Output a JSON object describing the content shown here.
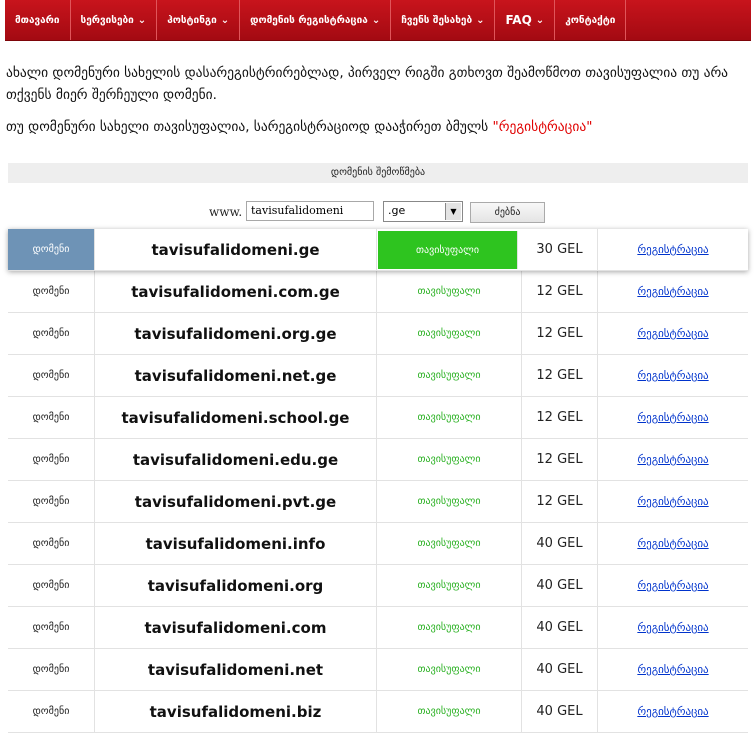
{
  "nav": {
    "items": [
      {
        "label": "მთავარი",
        "chevron": false
      },
      {
        "label": "სერვისები",
        "chevron": true
      },
      {
        "label": "ჰოსტინგი",
        "chevron": true
      },
      {
        "label": "დომენის რეგისტრაცია",
        "chevron": true
      },
      {
        "label": "ჩვენს შესახებ",
        "chevron": true
      },
      {
        "label": "FAQ",
        "chevron": true
      },
      {
        "label": "კონტაქტი",
        "chevron": false
      }
    ]
  },
  "intro": {
    "line1": "ახალი დომენური სახელის დასარეგისტრირებლად,  პირველ რიგში გთხოვთ შეამოწმოთ თავისუფალია თუ არა თქვენს მიერ შერჩეული დომენი.",
    "line2_prefix": "თუ დომენური სახელი თავისუფალია, სარეგისტრაციოდ დააჭირეთ ბმულს ",
    "line2_link": "\"რეგისტრაცია\""
  },
  "check": {
    "title": "დომენის შემოწმება",
    "www_label": "www.",
    "domain_value": "tavisufalidomeni",
    "tld_value": ".ge",
    "search_label": "ძებნა"
  },
  "results": [
    {
      "label": "დომენი",
      "domain": "tavisufalidomeni.ge",
      "status": "თავისუფალი",
      "price": "30 GEL",
      "action": "რეგისტრაცია"
    },
    {
      "label": "დომენი",
      "domain": "tavisufalidomeni.com.ge",
      "status": "თავისუფალი",
      "price": "12 GEL",
      "action": "რეგისტრაცია"
    },
    {
      "label": "დომენი",
      "domain": "tavisufalidomeni.org.ge",
      "status": "თავისუფალი",
      "price": "12 GEL",
      "action": "რეგისტრაცია"
    },
    {
      "label": "დომენი",
      "domain": "tavisufalidomeni.net.ge",
      "status": "თავისუფალი",
      "price": "12 GEL",
      "action": "რეგისტრაცია"
    },
    {
      "label": "დომენი",
      "domain": "tavisufalidomeni.school.ge",
      "status": "თავისუფალი",
      "price": "12 GEL",
      "action": "რეგისტრაცია"
    },
    {
      "label": "დომენი",
      "domain": "tavisufalidomeni.edu.ge",
      "status": "თავისუფალი",
      "price": "12 GEL",
      "action": "რეგისტრაცია"
    },
    {
      "label": "დომენი",
      "domain": "tavisufalidomeni.pvt.ge",
      "status": "თავისუფალი",
      "price": "12 GEL",
      "action": "რეგისტრაცია"
    },
    {
      "label": "დომენი",
      "domain": "tavisufalidomeni.info",
      "status": "თავისუფალი",
      "price": "40 GEL",
      "action": "რეგისტრაცია"
    },
    {
      "label": "დომენი",
      "domain": "tavisufalidomeni.org",
      "status": "თავისუფალი",
      "price": "40 GEL",
      "action": "რეგისტრაცია"
    },
    {
      "label": "დომენი",
      "domain": "tavisufalidomeni.com",
      "status": "თავისუფალი",
      "price": "40 GEL",
      "action": "რეგისტრაცია"
    },
    {
      "label": "დომენი",
      "domain": "tavisufalidomeni.net",
      "status": "თავისუფალი",
      "price": "40 GEL",
      "action": "რეგისტრაცია"
    },
    {
      "label": "დომენი",
      "domain": "tavisufalidomeni.biz",
      "status": "თავისუფალი",
      "price": "40 GEL",
      "action": "რეგისტრაცია"
    }
  ],
  "colors": {
    "nav_red": "#b80f17",
    "highlight_label": "#6e93b6",
    "status_green": "#2ec41f",
    "link_red": "#e00000",
    "link_blue": "#0033cc"
  }
}
